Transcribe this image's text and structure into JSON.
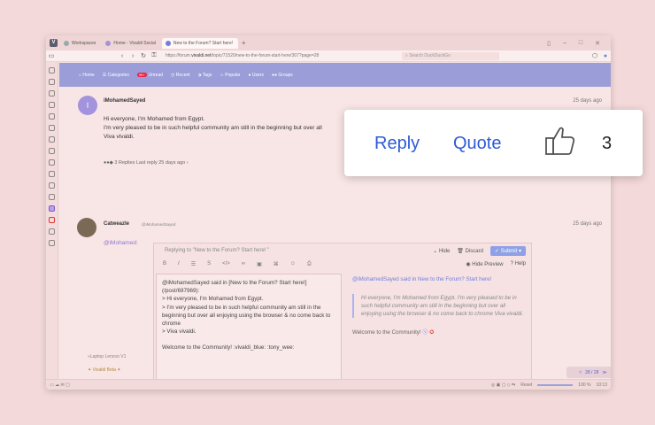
{
  "browser": {
    "tabs": [
      {
        "label": "Workspaces"
      },
      {
        "label": "Home - Vivaldi Social"
      },
      {
        "label": "New to the Forum? Start here!"
      }
    ],
    "url_prefix": "https://forum.",
    "url_domain": "vivaldi.net",
    "url_rest": "/topic/71520/new-to-the-forum-start-here/307?page=28",
    "search_placeholder": "Search DuckDuckGo"
  },
  "forum_nav": {
    "home": "Home",
    "categories": "Categories",
    "unread_badge": "99+",
    "unread": "Unread",
    "recent": "Recent",
    "tags": "Tags",
    "popular": "Popular",
    "users": "Users",
    "groups": "Groups"
  },
  "post1": {
    "avatar_letter": "I",
    "username": "iMohamedSayed",
    "time": "25 days ago",
    "line1": "Hi everyone, I'm Mohamed from Egypt.",
    "line2": "I'm very pleased to be in such helpful community am still in the beginning but over all",
    "line3": "Viva vivaldi.",
    "replies": "3 Replies Last reply 25 days ago"
  },
  "post2": {
    "username": "Catweazle",
    "handle": "@iMohamedSayed",
    "time": "25 days ago",
    "mention": "@iMohamed:"
  },
  "composer": {
    "replying_to": "Replying to \"New to the Forum? Start here! \"",
    "hide": "Hide",
    "discard": "Discard",
    "submit": "Submit",
    "hide_preview": "Hide Preview",
    "help": "Help",
    "editor_lines": [
      "@iMohamedSayed said in [New to the Forum? Start here!] (/post/697969):",
      "> Hi everyone, I'm Mohamed from Egypt.",
      "> I'm very pleased to be in such helpful community am still in the beginning but over all enjoying using the browser & no come back to chrome",
      "> Viva vivaldi."
    ],
    "editor_welcome": "Welcome to the Community! :vivaldi_blue: :tony_wee:",
    "preview_said": "@iMohamedSayed said in New to the Forum? Start here!",
    "preview_quote": "Hi everyone, I'm Mohamed from Egypt. I'm very pleased to be in such helpful community am still in the beginning but over all enjoying using the browser & no come back to chrome Viva vivaldi.",
    "preview_welcome": "Welcome to the Community!"
  },
  "misc": {
    "signature": "Vivaldi Beta",
    "laptop_line": "»Laptop Lenovo V1"
  },
  "pager": "28 / 28",
  "status": {
    "reset": "Reset",
    "zoom": "100 %",
    "clock": "10:13"
  },
  "callout": {
    "reply": "Reply",
    "quote": "Quote",
    "votes": "3"
  }
}
